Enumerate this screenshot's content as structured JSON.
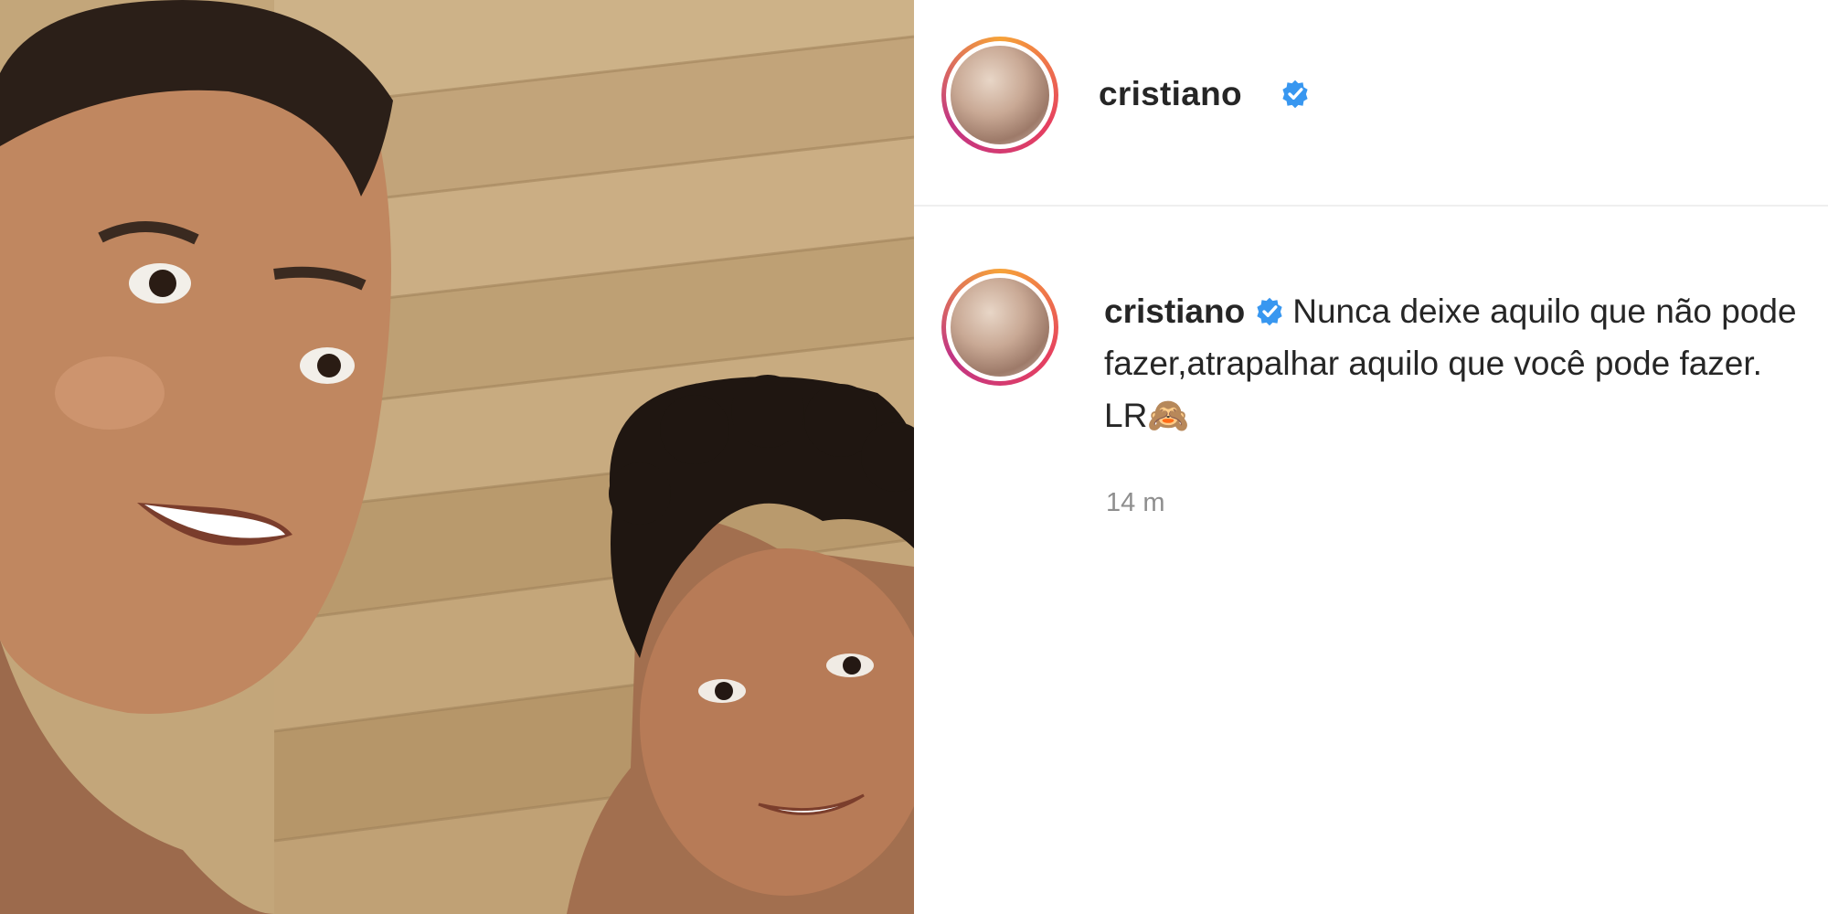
{
  "post": {
    "photo_alt": "selfie of a smiling man and a curly-haired boy in a wooden sauna",
    "header": {
      "username": "cristiano",
      "verified_icon": "verified-badge-icon"
    },
    "caption": {
      "username": "cristiano",
      "text": "Nunca deixe aquilo que não pode fazer,atrapalhar aquilo que você pode fazer. LR",
      "emoji": "🙈"
    },
    "timestamp": "14 m"
  },
  "colors": {
    "verified_blue": "#3897f0",
    "text": "#262626",
    "muted": "#8e8e8e",
    "divider": "#efefef"
  }
}
